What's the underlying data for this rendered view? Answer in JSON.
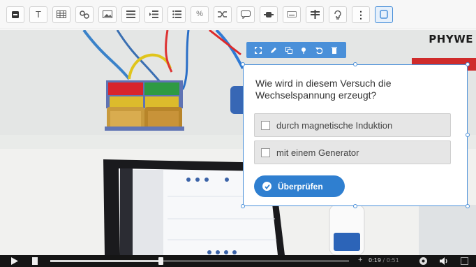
{
  "toolbar": {
    "items": [
      {
        "name": "text-block-button",
        "glyph": ""
      },
      {
        "name": "text-button",
        "glyph": "T"
      },
      {
        "name": "table-button",
        "glyph": ""
      },
      {
        "name": "link-button",
        "glyph": ""
      },
      {
        "name": "image-button",
        "glyph": ""
      },
      {
        "name": "align-button",
        "glyph": ""
      },
      {
        "name": "indent-button",
        "glyph": ""
      },
      {
        "name": "list-button",
        "glyph": ""
      },
      {
        "name": "percent-button",
        "glyph": "%"
      },
      {
        "name": "shuffle-button",
        "glyph": ""
      },
      {
        "name": "comment-button",
        "glyph": ""
      },
      {
        "name": "record-button",
        "glyph": ""
      },
      {
        "name": "keyboard-button",
        "glyph": ""
      },
      {
        "name": "strikethrough-button",
        "glyph": ""
      },
      {
        "name": "hint-button",
        "glyph": ""
      },
      {
        "name": "more-button",
        "glyph": "⋮"
      },
      {
        "name": "copy-button",
        "glyph": ""
      }
    ]
  },
  "logo": "PHYWE",
  "quiz": {
    "question": "Wie wird in diesem Versuch die Wechselspannung erzeugt?",
    "options": [
      {
        "label": "durch magnetische Induktion",
        "checked": false
      },
      {
        "label": "mit einem Generator",
        "checked": false
      }
    ],
    "submit_label": "Überprüfen"
  },
  "player": {
    "current_time": "0:19",
    "duration": "/ 0:51",
    "progress": 0.37,
    "colors": {
      "accent": "#2f7fd0",
      "bar": "#151515"
    }
  }
}
